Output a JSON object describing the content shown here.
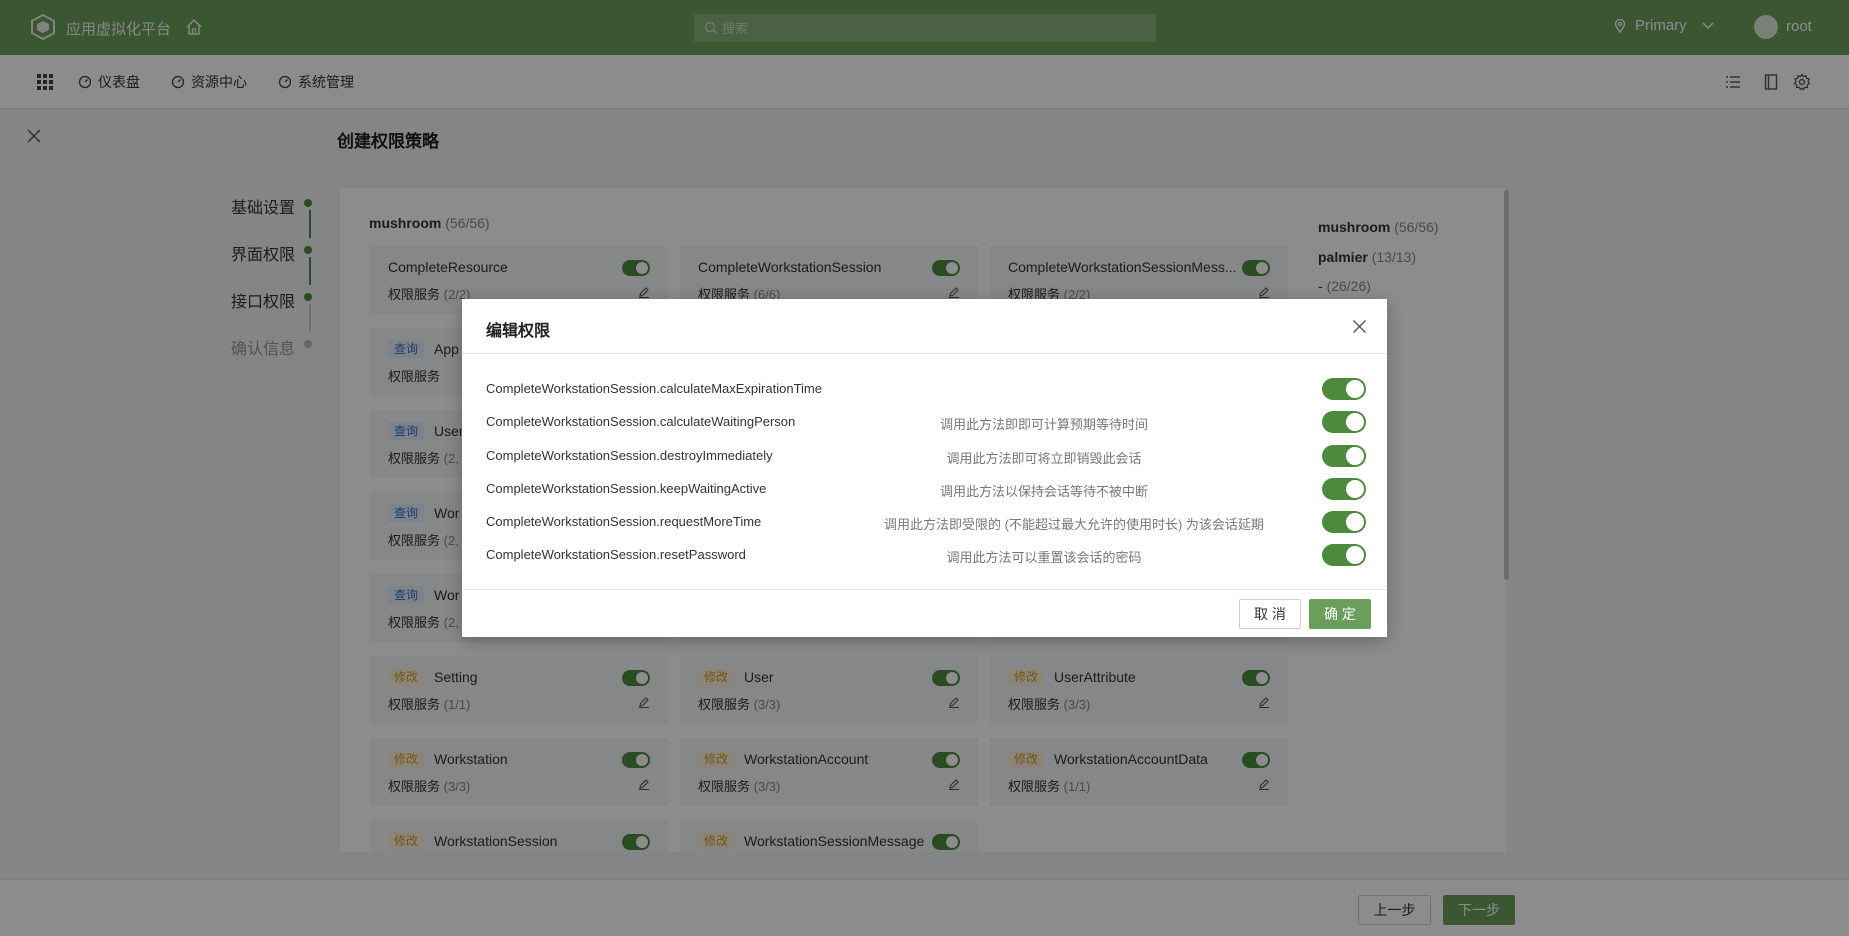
{
  "app": {
    "brand": "应用虚拟化平台"
  },
  "search": {
    "placeholder": "搜索"
  },
  "region": {
    "label": "Primary"
  },
  "user": {
    "name": "root"
  },
  "nav": {
    "items": [
      {
        "label": "仪表盘"
      },
      {
        "label": "资源中心"
      },
      {
        "label": "系统管理"
      }
    ]
  },
  "page": {
    "title": "创建权限策略"
  },
  "steps": [
    {
      "label": "基础设置",
      "state": "done"
    },
    {
      "label": "界面权限",
      "state": "done"
    },
    {
      "label": "接口权限",
      "state": "active"
    },
    {
      "label": "确认信息",
      "state": "pending"
    }
  ],
  "group": {
    "name": "mushroom",
    "count": "(56/56)"
  },
  "card_sub_label": "权限服务",
  "cards": [
    {
      "name": "CompleteResource",
      "tag": "",
      "sub": "(2/2)"
    },
    {
      "name": "CompleteWorkstationSession",
      "tag": "",
      "sub": "(6/6)"
    },
    {
      "name": "CompleteWorkstationSessionMess...",
      "tag": "",
      "sub": "(2/2)"
    },
    {
      "name": "App",
      "tag": "查询",
      "sub": ""
    },
    {
      "name": "User",
      "tag": "查询",
      "sub": "(2,"
    },
    {
      "name": "Wor",
      "tag": "查询",
      "sub": "(2,"
    },
    {
      "name": "Wor",
      "tag": "查询",
      "sub": "(2,"
    },
    {
      "name": "Setting",
      "tag": "修改",
      "sub": "(1/1)"
    },
    {
      "name": "User",
      "tag": "修改",
      "sub": "(3/3)"
    },
    {
      "name": "UserAttribute",
      "tag": "修改",
      "sub": "(3/3)"
    },
    {
      "name": "Workstation",
      "tag": "修改",
      "sub": "(3/3)"
    },
    {
      "name": "WorkstationAccount",
      "tag": "修改",
      "sub": "(3/3)"
    },
    {
      "name": "WorkstationAccountData",
      "tag": "修改",
      "sub": "(1/1)"
    },
    {
      "name": "WorkstationSession",
      "tag": "修改",
      "sub": ""
    },
    {
      "name": "WorkstationSessionMessage",
      "tag": "修改",
      "sub": ""
    }
  ],
  "side_list": [
    {
      "name": "mushroom",
      "count": "(56/56)"
    },
    {
      "name": "palmier",
      "count": "(13/13)"
    },
    {
      "name": "-",
      "count": "(26/26)"
    }
  ],
  "footer": {
    "prev_label": "上一步",
    "next_label": "下一步"
  },
  "modal": {
    "title": "编辑权限",
    "rows": [
      {
        "name": "CompleteWorkstationSession.calculateMaxExpirationTime",
        "desc": ""
      },
      {
        "name": "CompleteWorkstationSession.calculateWaitingPerson",
        "desc": "调用此方法即即可计算预期等待时间"
      },
      {
        "name": "CompleteWorkstationSession.destroyImmediately",
        "desc": "调用此方法即可将立即销毁此会话"
      },
      {
        "name": "CompleteWorkstationSession.keepWaitingActive",
        "desc": "调用此方法以保持会话等待不被中断"
      },
      {
        "name": "CompleteWorkstationSession.requestMoreTime",
        "desc": "调用此方法即受限的 (不能超过最大允许的使用时长) 为该会话延期"
      },
      {
        "name": "CompleteWorkstationSession.resetPassword",
        "desc": "调用此方法可以重置该会话的密码"
      }
    ],
    "cancel_label": "取 消",
    "ok_label": "确 定"
  },
  "colors": {
    "brand": "#6a9e5a",
    "toggle_on": "#4e8a3e",
    "tag_query": "#3470c7",
    "tag_modify": "#d39c26"
  }
}
